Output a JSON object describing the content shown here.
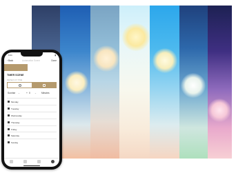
{
  "status_bar": {
    "time": "9:41",
    "battery": "100"
  },
  "nav": {
    "back_label": "Back",
    "title": "Automation Scene",
    "done_label": "Done"
  },
  "section": {
    "title": "TIMER SCENE",
    "subtitle": "REPEAT AT TIME"
  },
  "trigger_options": [
    {
      "icon": "clock-icon",
      "selected": false
    },
    {
      "icon": "sun-icon",
      "selected": true
    }
  ],
  "offset": {
    "event": "Sunrise",
    "sign": "+",
    "value": "0",
    "unit": "Minutes"
  },
  "days": [
    {
      "label": "Monday",
      "checked": true
    },
    {
      "label": "Tuesday",
      "checked": true
    },
    {
      "label": "Wednesday",
      "checked": true
    },
    {
      "label": "Thursday",
      "checked": true
    },
    {
      "label": "Friday",
      "checked": true
    },
    {
      "label": "Saturday",
      "checked": true
    },
    {
      "label": "Sunday",
      "checked": true
    }
  ],
  "tab_bar": [
    {
      "icon": "home-icon",
      "active": false
    },
    {
      "icon": "devices-icon",
      "active": false
    },
    {
      "icon": "scenes-icon",
      "active": false
    },
    {
      "icon": "settings-icon",
      "active": true
    }
  ],
  "colors": {
    "accent": "#b59a6d"
  }
}
